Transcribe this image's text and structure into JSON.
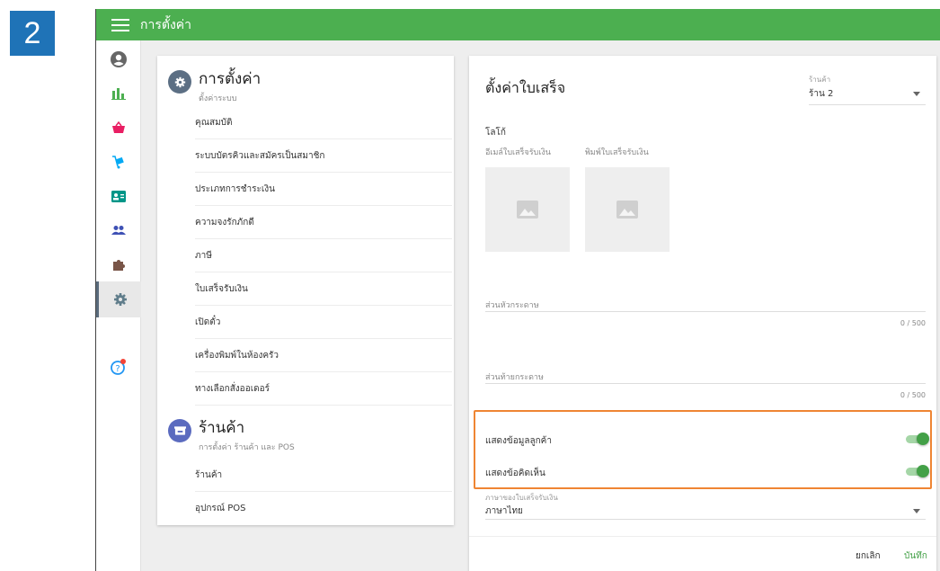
{
  "step_number": "2",
  "topbar": {
    "title": "การตั้งค่า"
  },
  "sidebar": {
    "items": [
      {
        "icon": "account-circle-icon",
        "color": "#666666"
      },
      {
        "icon": "bar-chart-icon",
        "color": "#4caf50"
      },
      {
        "icon": "shopping-basket-icon",
        "color": "#e91e63"
      },
      {
        "icon": "dolly-icon",
        "color": "#03a9f4"
      },
      {
        "icon": "contact-card-icon",
        "color": "#009688"
      },
      {
        "icon": "people-icon",
        "color": "#3f51b5"
      },
      {
        "icon": "puzzle-icon",
        "color": "#795548"
      },
      {
        "icon": "settings-icon",
        "color": "#607d8b",
        "active": true
      },
      {
        "icon": "help-icon",
        "color": "#2196f3"
      }
    ]
  },
  "left_panel": {
    "settings_section": {
      "title": "การตั้งค่า",
      "subtitle": "ตั้งค่าระบบ",
      "items": [
        "คุณสมบัติ",
        "ระบบบัตรคิวและสมัครเป็นสมาชิก",
        "ประเภทการชำระเงิน",
        "ความจงรักภักดี",
        "ภาษี",
        "ใบเสร็จรับเงิน",
        "เปิดตั๋ว",
        "เครื่องพิมพ์ในห้องครัว",
        "ทางเลือกสั่งออเดอร์"
      ]
    },
    "store_section": {
      "title": "ร้านค้า",
      "subtitle": "การตั้งค่า ร้านค้า และ POS",
      "items": [
        "ร้านค้า",
        "อุปกรณ์ POS"
      ]
    }
  },
  "receipt_settings": {
    "title": "ตั้งค่าใบเสร็จ",
    "store_select": {
      "label": "ร้านค้า",
      "value": "ร้าน 2"
    },
    "logo_label": "โลโก้",
    "email_receipt_label": "อีเมล์ใบเสร็จรับเงิน",
    "print_receipt_label": "พิมพ์ใบเสร็จรับเงิน",
    "header_field": {
      "placeholder": "ส่วนหัวกระดาษ",
      "counter": "0 / 500"
    },
    "footer_field": {
      "placeholder": "ส่วนท้ายกระดาษ",
      "counter": "0 / 500"
    },
    "toggles": [
      {
        "label": "แสดงข้อมูลลูกค้า",
        "on": true
      },
      {
        "label": "แสดงข้อคิดเห็น",
        "on": true
      }
    ],
    "language_select": {
      "label": "ภาษาของใบเสร็จรับเงิน",
      "value": "ภาษาไทย"
    },
    "cancel_label": "ยกเลิก",
    "save_label": "บันทึก"
  },
  "colors": {
    "accent_green": "#4caf50",
    "highlight_orange": "#ef8533"
  }
}
